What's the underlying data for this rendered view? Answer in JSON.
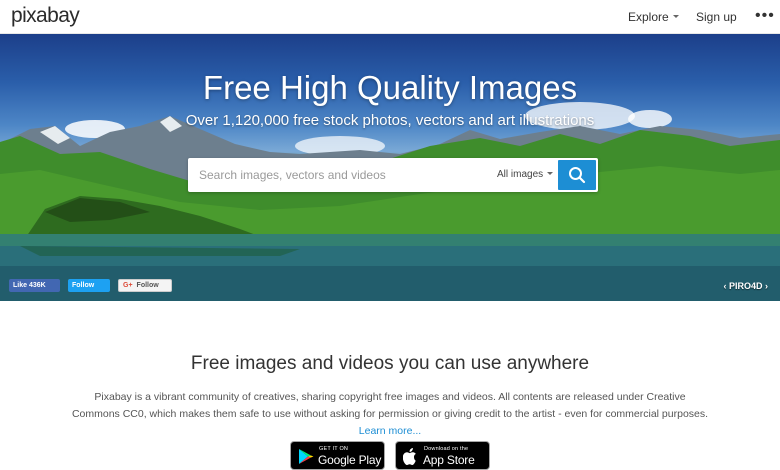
{
  "header": {
    "logo": "pixabay",
    "nav": {
      "explore": "Explore",
      "signup": "Sign up",
      "more": "•••"
    }
  },
  "hero": {
    "title": "Free High Quality Images",
    "subtitle": "Over 1,120,000 free stock photos, vectors and art illustrations",
    "search": {
      "placeholder": "Search images, vectors and videos",
      "value": "",
      "type_selected": "All images"
    },
    "social": {
      "facebook_like": "Like 436K",
      "twitter": "Follow",
      "google_plus": "Follow"
    },
    "photo_credit": "PIRO4D"
  },
  "intro": {
    "heading": "Free images and videos you can use anywhere",
    "text": "Pixabay is a vibrant community of creatives, sharing copyright free images and videos. All contents are released under Creative Commons CC0, which makes them safe to use without asking for permission or giving credit to the artist - even for commercial purposes.",
    "learn_more": "Learn more..."
  },
  "apps": {
    "google_play": {
      "small": "GET IT ON",
      "big": "Google Play"
    },
    "app_store": {
      "small": "Download on the",
      "big": "App Store"
    }
  },
  "colors": {
    "accent": "#1d8ed4",
    "facebook": "#4267b2",
    "twitter": "#1da1f2"
  }
}
